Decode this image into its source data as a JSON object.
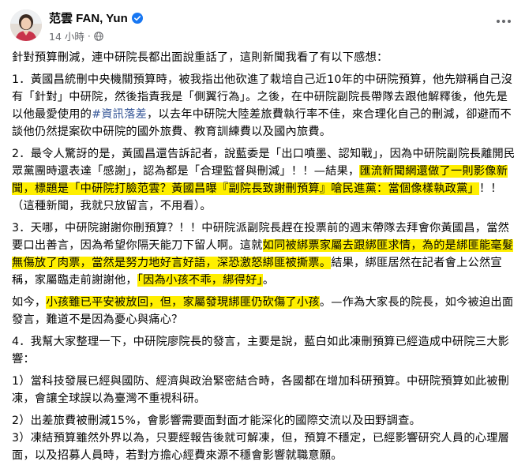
{
  "post": {
    "author": "范雲 FAN, Yun",
    "time": "14 小時",
    "dot": "·"
  },
  "paragraphs": [
    [
      {
        "t": "針對預算刪減，連中研院長都出面說重話了，這則新聞我看了有以下感想："
      }
    ],
    [
      {
        "t": "1．黃國昌統刪中央機關預算時，被我指出他砍進了栽培自己近10年的中研院預算，他先辯稱自己沒有「針對」中研院，然後指責我是「側翼行為」。之後，在中研院副院長帶隊去跟他解釋後，他先是以他最愛使用的"
      },
      {
        "t": "#資訊落差",
        "tag": true
      },
      {
        "t": "，以去年中研院大陸差旅費執行率不佳，來合理化自己的刪減，卻避而不談他仍然提案砍中研院的國外旅費、教育訓練費以及國內旅費。"
      }
    ],
    [
      {
        "t": "2．最令人驚訝的是，黃國昌還告訴記者，說藍委是「出口噴墨、認知戰」，因為中研院副院長離開民眾黨團時還表達「感謝」，認為都是「合理監督與刪減」！！—結果，"
      },
      {
        "t": "匯流新聞網還做了一則影像新聞，標題是「中研院打臉范雲？黃國昌曝『副院長致謝刪預算』嗆民進黨：當個像樣執政黨」",
        "hl": true
      },
      {
        "t": "！！（這種新聞，我就只放留言，不用看）。"
      }
    ],
    [
      {
        "t": "3．天哪，中研院謝謝你刪預算？！！中研院派副院長趕在投票前的週末帶隊去拜會你黃國昌，當然要口出善言，因為希望你隔天能刀下留人啊。這就"
      },
      {
        "t": "如同被綁票家屬去跟綁匪求情，為的是綁匪能毫髮無傷放了肉票，當然是努力地好言好語，深恐激怒綁匪被撕票。",
        "hl": true
      },
      {
        "t": "結果，綁匪居然在記者會上公然宣稱，家屬臨走前謝謝他，"
      },
      {
        "t": "「因為小孩不乖，綁得好」",
        "hl": true
      },
      {
        "t": "。"
      }
    ],
    [
      {
        "t": "如今，"
      },
      {
        "t": "小孩雖已平安被放回，但，家屬發現綁匪仍砍傷了小孩",
        "hl": true
      },
      {
        "t": "。—作為大家長的院長，如今被迫出面發言，難道不是因為憂心與痛心？"
      }
    ],
    [
      {
        "t": "4．我幫大家整理一下，中研院廖院長的發言，主要是說，藍白如此凍刪預算已經造成中研院三大影響："
      }
    ],
    [
      {
        "t": "1）當科技發展已經與國防、經濟與政治緊密結合時，各國都在增加科研預算。中研院預算如此被刪凍，會讓全球誤以為臺灣不重視科研。"
      }
    ],
    [
      {
        "t": "2）出差旅費被刪減15%，會影響需要面對面才能深化的國際交流以及田野調查。"
      },
      {
        "br": true
      },
      {
        "t": "3）凍結預算雖然外界以為，只要經報告後就可解凍，但，預算不穩定，已經影響研究人員的心理層面，以及招募人員時，若對方擔心經費來源不穩會影響就職意願。"
      }
    ]
  ]
}
